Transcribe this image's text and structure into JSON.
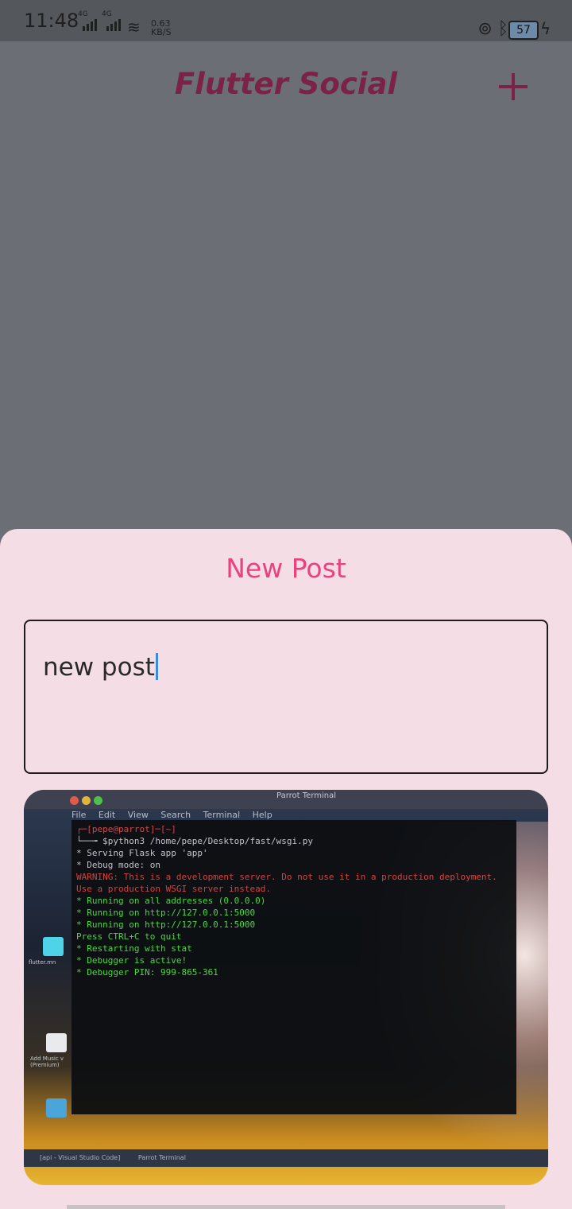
{
  "status_bar": {
    "time": "11:48",
    "signal1_label": "4G",
    "signal2_label": "4G",
    "net_speed_value": "0.63",
    "net_speed_unit": "KB/S",
    "battery_level": "57"
  },
  "app_bar": {
    "title": "Flutter Social",
    "add_icon": "plus-icon"
  },
  "sheet": {
    "title": "New Post",
    "post_input": {
      "value": "new post"
    }
  },
  "preview_image": {
    "window_title": "Parrot Terminal",
    "menu": [
      "File",
      "Edit",
      "View",
      "Search",
      "Terminal",
      "Help"
    ],
    "terminal_lines": [
      {
        "text": "┌─[pepe@parrot]─[~]",
        "style": "prompt"
      },
      {
        "text": "└──╼ $python3 /home/pepe/Desktop/fast/wsgi.py",
        "style": "white"
      },
      {
        "text": " * Serving Flask app 'app'",
        "style": "white"
      },
      {
        "text": " * Debug mode: on",
        "style": "white"
      },
      {
        "text": "WARNING: This is a development server. Do not use it in a production deployment.",
        "style": "red"
      },
      {
        "text": " Use a production WSGI server instead.",
        "style": "red"
      },
      {
        "text": " * Running on all addresses (0.0.0.0)",
        "style": "green"
      },
      {
        "text": " * Running on http://127.0.0.1:5000",
        "style": "green"
      },
      {
        "text": " * Running on http://127.0.0.1:5000",
        "style": "green"
      },
      {
        "text": "Press CTRL+C to quit",
        "style": "green"
      },
      {
        "text": " * Restarting with stat",
        "style": "green"
      },
      {
        "text": " * Debugger is active!",
        "style": "green"
      },
      {
        "text": " * Debugger PIN: 999-865-361",
        "style": "green"
      }
    ],
    "taskbar_items": [
      "[api - Visual Studio Code]",
      "Parrot Terminal"
    ],
    "desktop_labels": [
      "flutter.mn",
      "Add Music v (Premium)"
    ]
  },
  "colors": {
    "accent": "#e8437e",
    "title_dim": "#7a2347",
    "sheet_bg": "#f5dde6",
    "scrim": "#6b6e74"
  }
}
